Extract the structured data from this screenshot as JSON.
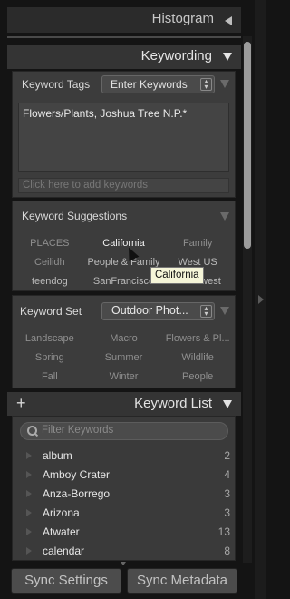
{
  "histogram": {
    "title": "Histogram"
  },
  "keywording": {
    "title": "Keywording",
    "keyword_tags": {
      "label": "Keyword Tags",
      "mode": "Enter Keywords",
      "content": "Flowers/Plants, Joshua Tree N.P.*",
      "placeholder": "Click here to add keywords"
    },
    "suggestions": {
      "label": "Keyword Suggestions",
      "items": [
        "PLACES",
        "California",
        "Family",
        "Ceilidh",
        "People & Family",
        "West US",
        "teendog",
        "SanFrancisco",
        "Southwest"
      ],
      "tooltip": "California"
    },
    "keyword_set": {
      "label": "Keyword Set",
      "selected": "Outdoor Phot...",
      "items": [
        "Landscape",
        "Macro",
        "Flowers & Pl...",
        "Spring",
        "Summer",
        "Wildlife",
        "Fall",
        "Winter",
        "People"
      ]
    }
  },
  "keyword_list": {
    "add_symbol": "+",
    "title": "Keyword List",
    "filter_placeholder": "Filter Keywords",
    "items": [
      {
        "name": "album",
        "count": "2"
      },
      {
        "name": "Amboy Crater",
        "count": "4"
      },
      {
        "name": "Anza-Borrego",
        "count": "3"
      },
      {
        "name": "Arizona",
        "count": "3"
      },
      {
        "name": "Atwater",
        "count": "13"
      },
      {
        "name": "calendar",
        "count": "8"
      }
    ]
  },
  "buttons": {
    "sync_settings": "Sync Settings",
    "sync_metadata": "Sync Metadata"
  }
}
